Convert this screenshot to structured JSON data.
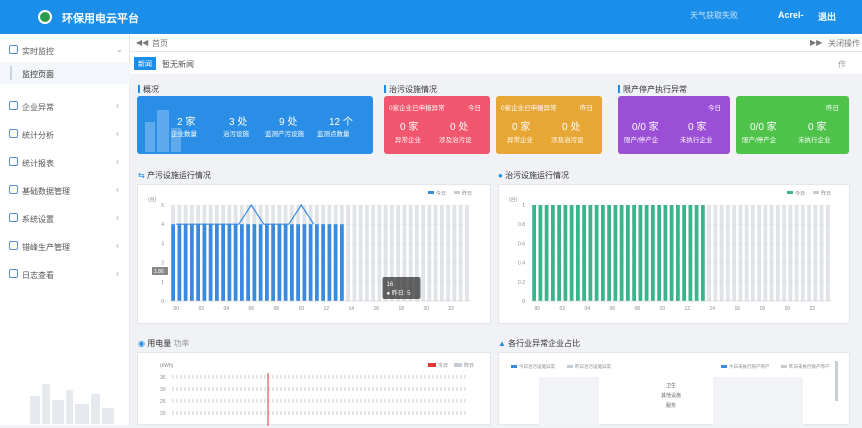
{
  "header": {
    "title": "环保用电云平台",
    "weather": "天气获取失败",
    "user": "Acrel-",
    "logout": "退出"
  },
  "sidebar": {
    "items": [
      {
        "label": "实时监控",
        "icon": "monitor-icon",
        "arrow": "⌄"
      },
      {
        "label": "企业异常",
        "icon": "alert-icon",
        "arrow": "‹"
      },
      {
        "label": "统计分析",
        "icon": "bar-chart-icon",
        "arrow": "‹"
      },
      {
        "label": "统计报表",
        "icon": "report-icon",
        "arrow": "‹"
      },
      {
        "label": "基础数据管理",
        "icon": "database-icon",
        "arrow": "‹"
      },
      {
        "label": "系统设置",
        "icon": "gear-icon",
        "arrow": "‹"
      },
      {
        "label": "错峰生产管理",
        "icon": "calendar-icon",
        "arrow": "‹"
      },
      {
        "label": "日志查看",
        "icon": "log-icon",
        "arrow": "‹"
      }
    ],
    "sub_item": "监控页面"
  },
  "tabs": {
    "nav": "◀◀",
    "home": "首页",
    "right": "▶▶",
    "close": "关闭操作"
  },
  "news": {
    "badge": "新闻",
    "text": "暂无新闻",
    "right": "作"
  },
  "sections": {
    "overview": "概况",
    "pollution": "治污设施情况",
    "limit": "限产停产执行异常",
    "production_chart": "产污设施运行情况",
    "treatment_chart": "治污设施运行情况",
    "power": "用电量",
    "power_tab": "功率",
    "industry": "各行业异常企业占比"
  },
  "overview": [
    {
      "value": "2 家",
      "label": "企业数量"
    },
    {
      "value": "3 处",
      "label": "治污设施"
    },
    {
      "value": "9 处",
      "label": "监测产污设施"
    },
    {
      "value": "12 个",
      "label": "监测点数量"
    }
  ],
  "pollution_cards": [
    {
      "header": "0家企业已申报异常",
      "day": "今日",
      "v1": "0 家",
      "l1": "异常企业",
      "v2": "0 处",
      "l2": "涉及治污设",
      "color": "#f0566e"
    },
    {
      "header": "0家企业已申报异常",
      "day": "昨日",
      "v1": "0 家",
      "l1": "异常企业",
      "v2": "0 处",
      "l2": "涉及治污设",
      "color": "#e7a735"
    }
  ],
  "limit_cards": [
    {
      "day": "今日",
      "v1": "0/0 家",
      "l1": "限产/停产企",
      "v2": "0 家",
      "l2": "未执行企业",
      "color": "#9b4fd6"
    },
    {
      "day": "昨日",
      "v1": "0/0 家",
      "l1": "限产/停产企",
      "v2": "0 家",
      "l2": "未执行企业",
      "color": "#4fc24a"
    }
  ],
  "chart_data": [
    {
      "type": "bar",
      "title": "产污设施运行情况",
      "ylabel": "(台)",
      "ylim": [
        0,
        5
      ],
      "yticks": [
        0,
        1,
        2,
        3,
        4,
        5
      ],
      "xticks": [
        "00",
        "02",
        "04",
        "06",
        "08",
        "10",
        "12",
        "14",
        "16",
        "18",
        "20",
        "22"
      ],
      "series": [
        {
          "name": "今日",
          "color": "#3a8be0",
          "values": [
            4,
            4,
            4,
            4,
            4,
            4,
            4,
            4,
            4,
            4,
            4,
            4,
            4,
            4,
            4,
            4,
            4,
            4,
            4,
            4,
            4,
            4,
            4,
            4,
            4,
            4,
            4,
            4
          ]
        },
        {
          "name": "昨日",
          "color": "#c6ccd6",
          "values": [
            5,
            5,
            5,
            5,
            5,
            5,
            5,
            5,
            5,
            5,
            5,
            5,
            5,
            5,
            5,
            5,
            5,
            5,
            5,
            5,
            5,
            5,
            5,
            5,
            5,
            5,
            5,
            5,
            5,
            5,
            5,
            5,
            5,
            5,
            5,
            5,
            5,
            5,
            5,
            5,
            5,
            5,
            5,
            5,
            5,
            5,
            5,
            5
          ]
        }
      ],
      "line_values": [
        4,
        4,
        4,
        4,
        4,
        4,
        5,
        4,
        4,
        4,
        5,
        4
      ],
      "tooltip": {
        "x": "16",
        "text": "昨日: 5"
      },
      "crosshair_label": "1.86"
    },
    {
      "type": "bar",
      "title": "治污设施运行情况",
      "ylabel": "(台)",
      "ylim": [
        0,
        1
      ],
      "yticks": [
        "0",
        "0.2",
        "0.4",
        "0.6",
        "0.8",
        "1"
      ],
      "xticks": [
        "00",
        "02",
        "04",
        "06",
        "08",
        "10",
        "12",
        "14",
        "16",
        "18",
        "20",
        "22"
      ],
      "series": [
        {
          "name": "今日",
          "color": "#3ab58a",
          "values": [
            1,
            1,
            1,
            1,
            1,
            1,
            1,
            1,
            1,
            1,
            1,
            1,
            1,
            1,
            1,
            1,
            1,
            1,
            1,
            1,
            1,
            1,
            1,
            1,
            1,
            1,
            1,
            1
          ]
        },
        {
          "name": "昨日",
          "color": "#c6ccd6",
          "values": [
            1,
            1,
            1,
            1,
            1,
            1,
            1,
            1,
            1,
            1,
            1,
            1,
            1,
            1,
            1,
            1,
            1,
            1,
            1,
            1,
            1,
            1,
            1,
            1,
            1,
            1,
            1,
            1,
            1,
            1,
            1,
            1,
            1,
            1,
            1,
            1,
            1,
            1,
            1,
            1,
            1,
            1,
            1,
            1,
            1,
            1,
            1,
            1
          ]
        }
      ]
    },
    {
      "type": "line",
      "title": "用电量",
      "ylabel": "(kWh)",
      "yticks": [
        "35",
        "30",
        "25",
        "20"
      ],
      "series": [
        {
          "name": "今日",
          "color": "#e03a3a"
        },
        {
          "name": "昨日",
          "color": "#c6ccd6"
        }
      ]
    },
    {
      "type": "bar",
      "title": "各行业异常企业占比",
      "legend_left": [
        "今日治污设施异常",
        "昨日治污设施异常"
      ],
      "legend_right": [
        "今日未执行限产停产",
        "昨日未执行限产停产"
      ],
      "categories": [
        "卫生",
        "其他设施",
        "服务"
      ]
    }
  ]
}
